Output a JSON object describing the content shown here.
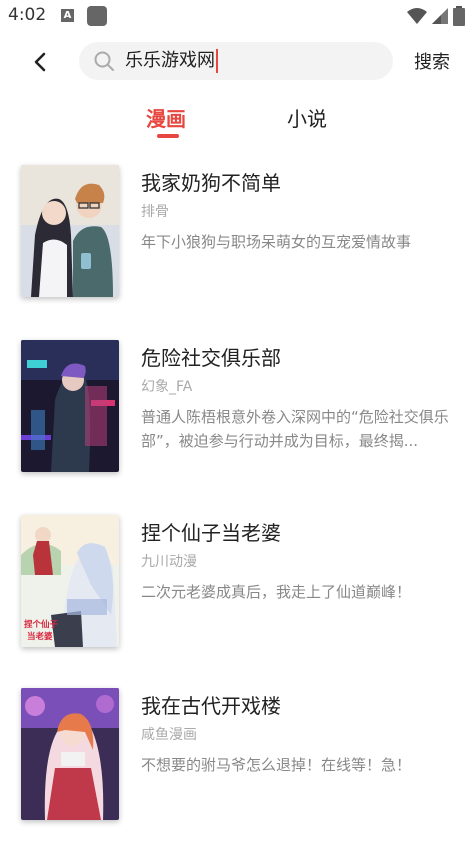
{
  "status": {
    "time": "4:02",
    "a_icon": "A"
  },
  "search": {
    "query": "乐乐游戏网",
    "button_label": "搜索"
  },
  "tabs": [
    {
      "label": "漫画",
      "active": true
    },
    {
      "label": "小说",
      "active": false
    }
  ],
  "results": [
    {
      "title": "我家奶狗不简单",
      "author": "排骨",
      "desc": "年下小狼狗与职场呆萌女的互宠爱情故事"
    },
    {
      "title": "危险社交俱乐部",
      "author": "幻象_FA",
      "desc": "普通人陈梧根意外卷入深网中的“危险社交俱乐部”，被迫参与行动并成为目标，最终揭..."
    },
    {
      "title": "捏个仙子当老婆",
      "author": "九川动漫",
      "desc": "二次元老婆成真后，我走上了仙道巅峰！",
      "cover_text": "捏个仙子当老婆"
    },
    {
      "title": "我在古代开戏楼",
      "author": "咸鱼漫画",
      "desc": "不想要的驸马爷怎么退掉！在线等！急！"
    }
  ],
  "colors": {
    "accent": "#e8473f",
    "text": "#222222",
    "muted": "#aaaaaa"
  }
}
